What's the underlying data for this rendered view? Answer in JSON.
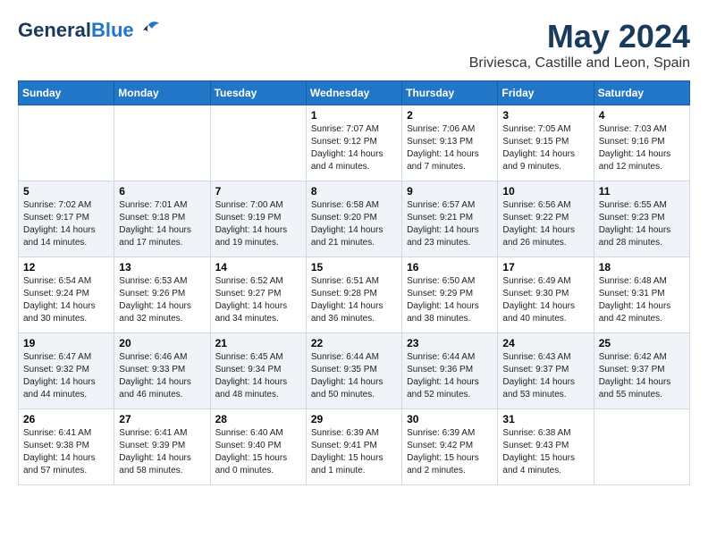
{
  "header": {
    "logo_general": "General",
    "logo_blue": "Blue",
    "main_title": "May 2024",
    "subtitle": "Briviesca, Castille and Leon, Spain"
  },
  "days_of_week": [
    "Sunday",
    "Monday",
    "Tuesday",
    "Wednesday",
    "Thursday",
    "Friday",
    "Saturday"
  ],
  "weeks": [
    [
      {
        "day": "",
        "info": ""
      },
      {
        "day": "",
        "info": ""
      },
      {
        "day": "",
        "info": ""
      },
      {
        "day": "1",
        "info": "Sunrise: 7:07 AM\nSunset: 9:12 PM\nDaylight: 14 hours\nand 4 minutes."
      },
      {
        "day": "2",
        "info": "Sunrise: 7:06 AM\nSunset: 9:13 PM\nDaylight: 14 hours\nand 7 minutes."
      },
      {
        "day": "3",
        "info": "Sunrise: 7:05 AM\nSunset: 9:15 PM\nDaylight: 14 hours\nand 9 minutes."
      },
      {
        "day": "4",
        "info": "Sunrise: 7:03 AM\nSunset: 9:16 PM\nDaylight: 14 hours\nand 12 minutes."
      }
    ],
    [
      {
        "day": "5",
        "info": "Sunrise: 7:02 AM\nSunset: 9:17 PM\nDaylight: 14 hours\nand 14 minutes."
      },
      {
        "day": "6",
        "info": "Sunrise: 7:01 AM\nSunset: 9:18 PM\nDaylight: 14 hours\nand 17 minutes."
      },
      {
        "day": "7",
        "info": "Sunrise: 7:00 AM\nSunset: 9:19 PM\nDaylight: 14 hours\nand 19 minutes."
      },
      {
        "day": "8",
        "info": "Sunrise: 6:58 AM\nSunset: 9:20 PM\nDaylight: 14 hours\nand 21 minutes."
      },
      {
        "day": "9",
        "info": "Sunrise: 6:57 AM\nSunset: 9:21 PM\nDaylight: 14 hours\nand 23 minutes."
      },
      {
        "day": "10",
        "info": "Sunrise: 6:56 AM\nSunset: 9:22 PM\nDaylight: 14 hours\nand 26 minutes."
      },
      {
        "day": "11",
        "info": "Sunrise: 6:55 AM\nSunset: 9:23 PM\nDaylight: 14 hours\nand 28 minutes."
      }
    ],
    [
      {
        "day": "12",
        "info": "Sunrise: 6:54 AM\nSunset: 9:24 PM\nDaylight: 14 hours\nand 30 minutes."
      },
      {
        "day": "13",
        "info": "Sunrise: 6:53 AM\nSunset: 9:26 PM\nDaylight: 14 hours\nand 32 minutes."
      },
      {
        "day": "14",
        "info": "Sunrise: 6:52 AM\nSunset: 9:27 PM\nDaylight: 14 hours\nand 34 minutes."
      },
      {
        "day": "15",
        "info": "Sunrise: 6:51 AM\nSunset: 9:28 PM\nDaylight: 14 hours\nand 36 minutes."
      },
      {
        "day": "16",
        "info": "Sunrise: 6:50 AM\nSunset: 9:29 PM\nDaylight: 14 hours\nand 38 minutes."
      },
      {
        "day": "17",
        "info": "Sunrise: 6:49 AM\nSunset: 9:30 PM\nDaylight: 14 hours\nand 40 minutes."
      },
      {
        "day": "18",
        "info": "Sunrise: 6:48 AM\nSunset: 9:31 PM\nDaylight: 14 hours\nand 42 minutes."
      }
    ],
    [
      {
        "day": "19",
        "info": "Sunrise: 6:47 AM\nSunset: 9:32 PM\nDaylight: 14 hours\nand 44 minutes."
      },
      {
        "day": "20",
        "info": "Sunrise: 6:46 AM\nSunset: 9:33 PM\nDaylight: 14 hours\nand 46 minutes."
      },
      {
        "day": "21",
        "info": "Sunrise: 6:45 AM\nSunset: 9:34 PM\nDaylight: 14 hours\nand 48 minutes."
      },
      {
        "day": "22",
        "info": "Sunrise: 6:44 AM\nSunset: 9:35 PM\nDaylight: 14 hours\nand 50 minutes."
      },
      {
        "day": "23",
        "info": "Sunrise: 6:44 AM\nSunset: 9:36 PM\nDaylight: 14 hours\nand 52 minutes."
      },
      {
        "day": "24",
        "info": "Sunrise: 6:43 AM\nSunset: 9:37 PM\nDaylight: 14 hours\nand 53 minutes."
      },
      {
        "day": "25",
        "info": "Sunrise: 6:42 AM\nSunset: 9:37 PM\nDaylight: 14 hours\nand 55 minutes."
      }
    ],
    [
      {
        "day": "26",
        "info": "Sunrise: 6:41 AM\nSunset: 9:38 PM\nDaylight: 14 hours\nand 57 minutes."
      },
      {
        "day": "27",
        "info": "Sunrise: 6:41 AM\nSunset: 9:39 PM\nDaylight: 14 hours\nand 58 minutes."
      },
      {
        "day": "28",
        "info": "Sunrise: 6:40 AM\nSunset: 9:40 PM\nDaylight: 15 hours\nand 0 minutes."
      },
      {
        "day": "29",
        "info": "Sunrise: 6:39 AM\nSunset: 9:41 PM\nDaylight: 15 hours\nand 1 minute."
      },
      {
        "day": "30",
        "info": "Sunrise: 6:39 AM\nSunset: 9:42 PM\nDaylight: 15 hours\nand 2 minutes."
      },
      {
        "day": "31",
        "info": "Sunrise: 6:38 AM\nSunset: 9:43 PM\nDaylight: 15 hours\nand 4 minutes."
      },
      {
        "day": "",
        "info": ""
      }
    ]
  ]
}
